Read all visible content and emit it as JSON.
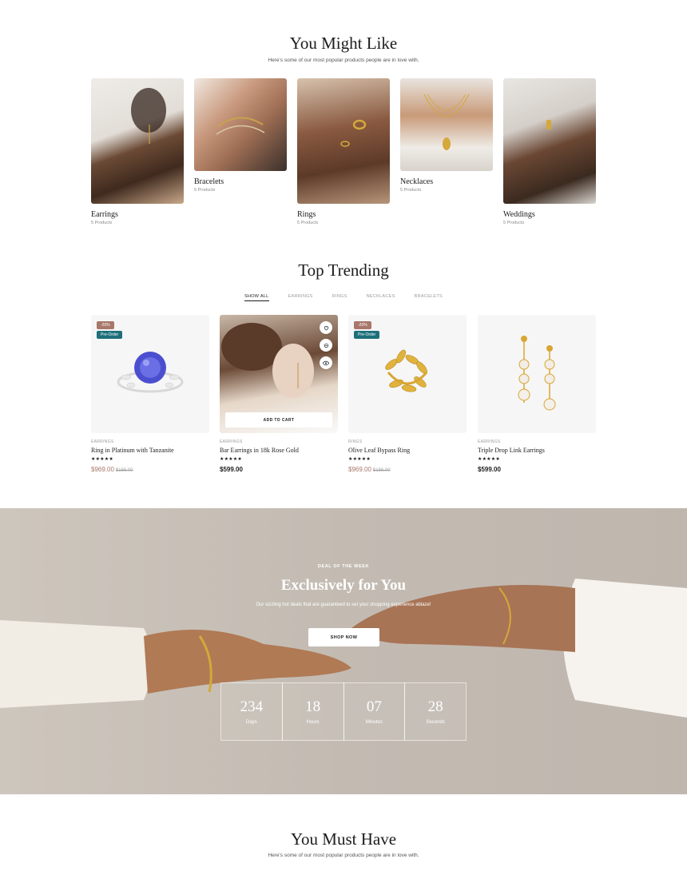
{
  "might_like": {
    "title": "You Might Like",
    "subtitle": "Here's some of our most popular products people are in love with.",
    "categories": [
      {
        "name": "Earrings",
        "count": "5 Products"
      },
      {
        "name": "Bracelets",
        "count": "5 Products"
      },
      {
        "name": "Rings",
        "count": "5 Products"
      },
      {
        "name": "Necklaces",
        "count": "5 Products"
      },
      {
        "name": "Weddings",
        "count": "5 Products"
      }
    ]
  },
  "trending": {
    "title": "Top Trending",
    "tabs": [
      "SHOW ALL",
      "EARRINGS",
      "RINGS",
      "NECKLACES",
      "BRACELETS"
    ],
    "active_tab": "SHOW ALL",
    "add_to_cart": "ADD TO CART",
    "products": [
      {
        "category": "EARRINGS",
        "name": "Ring in Platinum with Tanzanite",
        "stars": "★★★★★",
        "price": "$969.00",
        "old_price": "$156.00",
        "badge_sale": "-20%",
        "badge_pre": "Pre-Order"
      },
      {
        "category": "EARRINGS",
        "name": "Bar Earrings in 18k Rose Gold",
        "stars": "★★★★★",
        "price": "$599.00"
      },
      {
        "category": "RINGS",
        "name": "Olive Leaf Bypass Ring",
        "stars": "★★★★★",
        "price": "$969.00",
        "old_price": "$156.00",
        "badge_sale": "-20%",
        "badge_pre": "Pre-Order"
      },
      {
        "category": "EARRINGS",
        "name": "Triple Drop Link Earrings",
        "stars": "★★★★★",
        "price": "$599.00"
      }
    ],
    "colors": {
      "sale": "#a8776a",
      "preorder": "#1e6f7a"
    },
    "icons": [
      "heart-icon",
      "compare-icon",
      "eye-icon"
    ]
  },
  "deal": {
    "tag": "DEAL OF THE WEEK",
    "title": "Exclusively for You",
    "subtitle": "Our sizzling hot deals that are guaranteed to set your shopping experience ablaze!",
    "button": "SHOP NOW",
    "countdown": [
      {
        "value": "234",
        "label": "Days"
      },
      {
        "value": "18",
        "label": "Hours"
      },
      {
        "value": "07",
        "label": "Minutes"
      },
      {
        "value": "28",
        "label": "Seconds"
      }
    ]
  },
  "must_have": {
    "title": "You Must Have",
    "subtitle": "Here's some of our most popular products people are in love with."
  }
}
